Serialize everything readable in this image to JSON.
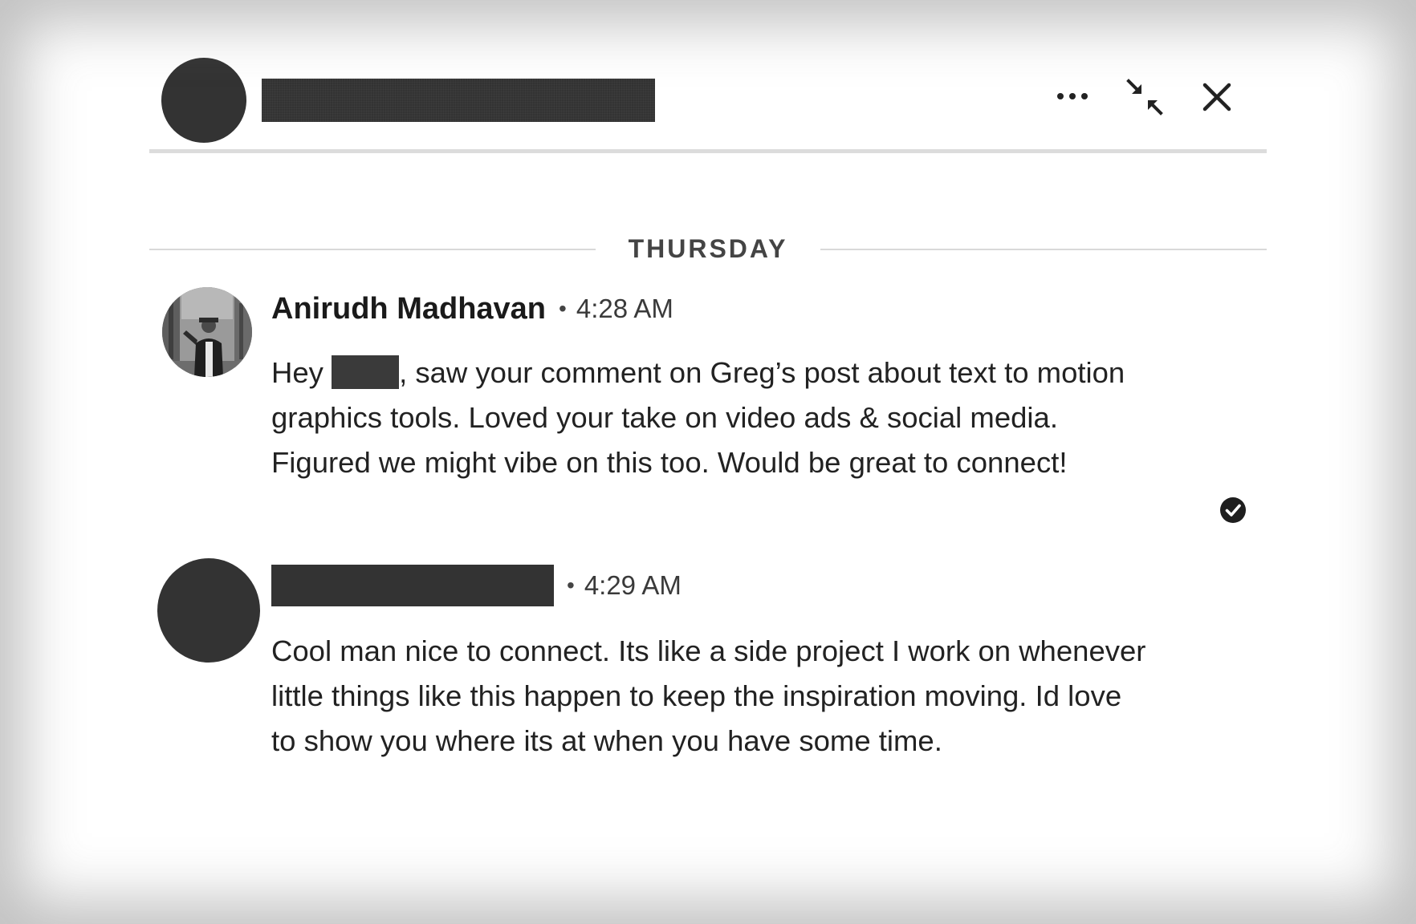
{
  "header": {
    "more_icon": "more-horizontal-icon",
    "minimize_icon": "minimize-arrows-icon",
    "close_icon": "close-icon"
  },
  "date_divider": "THURSDAY",
  "messages": [
    {
      "sender": "Anirudh Madhavan",
      "time": "4:28 AM",
      "text_before_redaction": "Hey ",
      "text_after_redaction": ", saw your comment on Greg’s post about text to motion graphics tools. Loved your take on video ads & social media. Figured we might vibe on this too. Would be great to connect!",
      "read_receipt_icon": "check-circle-icon"
    },
    {
      "time": "4:29 AM",
      "text": "Cool man nice to connect. Its like a side project I work on whenever little things like this happen to keep the inspiration moving. Id love to show you where its at when you have some time."
    }
  ],
  "colors": {
    "redaction": "#333333",
    "divider": "#dcdcdc",
    "text": "#222222"
  }
}
